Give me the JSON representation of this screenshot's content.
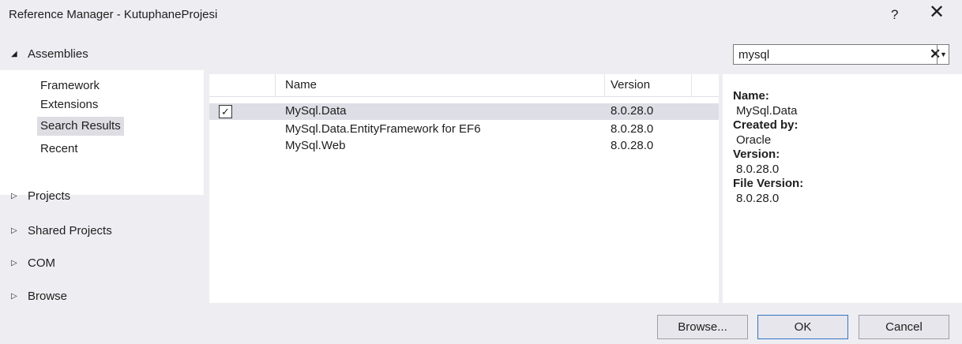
{
  "window": {
    "title": "Reference Manager - KutuphaneProjesi",
    "help_label": "?",
    "close_label": "✕"
  },
  "sidebar": {
    "assemblies": {
      "label": "Assemblies",
      "expanded": true,
      "items": [
        {
          "label": "Framework"
        },
        {
          "label": "Extensions"
        },
        {
          "label": "Search Results",
          "selected": true
        },
        {
          "label": "Recent"
        }
      ]
    },
    "groups": [
      {
        "label": "Projects"
      },
      {
        "label": "Shared Projects"
      },
      {
        "label": "COM"
      },
      {
        "label": "Browse"
      }
    ]
  },
  "search": {
    "value": "mysql",
    "clear_label": "✕",
    "dropdown_label": "▼"
  },
  "list": {
    "columns": {
      "name": "Name",
      "version": "Version"
    },
    "rows": [
      {
        "name": "MySql.Data",
        "version": "8.0.28.0",
        "checked": true,
        "selected": true
      },
      {
        "name": "MySql.Data.EntityFramework for EF6",
        "version": "8.0.28.0",
        "checked": false,
        "selected": false
      },
      {
        "name": "MySql.Web",
        "version": "8.0.28.0",
        "checked": false,
        "selected": false
      }
    ]
  },
  "details": {
    "name_label": "Name:",
    "name_value": "MySql.Data",
    "created_by_label": "Created by:",
    "created_by_value": "Oracle",
    "version_label": "Version:",
    "version_value": "8.0.28.0",
    "file_version_label": "File Version:",
    "file_version_value": "8.0.28.0"
  },
  "buttons": {
    "browse": "Browse...",
    "ok": "OK",
    "cancel": "Cancel"
  },
  "colors": {
    "window_bg": "#eeeef2",
    "panel_bg": "#ffffff",
    "selection": "#dedee6",
    "primary_border": "#3276c3"
  }
}
